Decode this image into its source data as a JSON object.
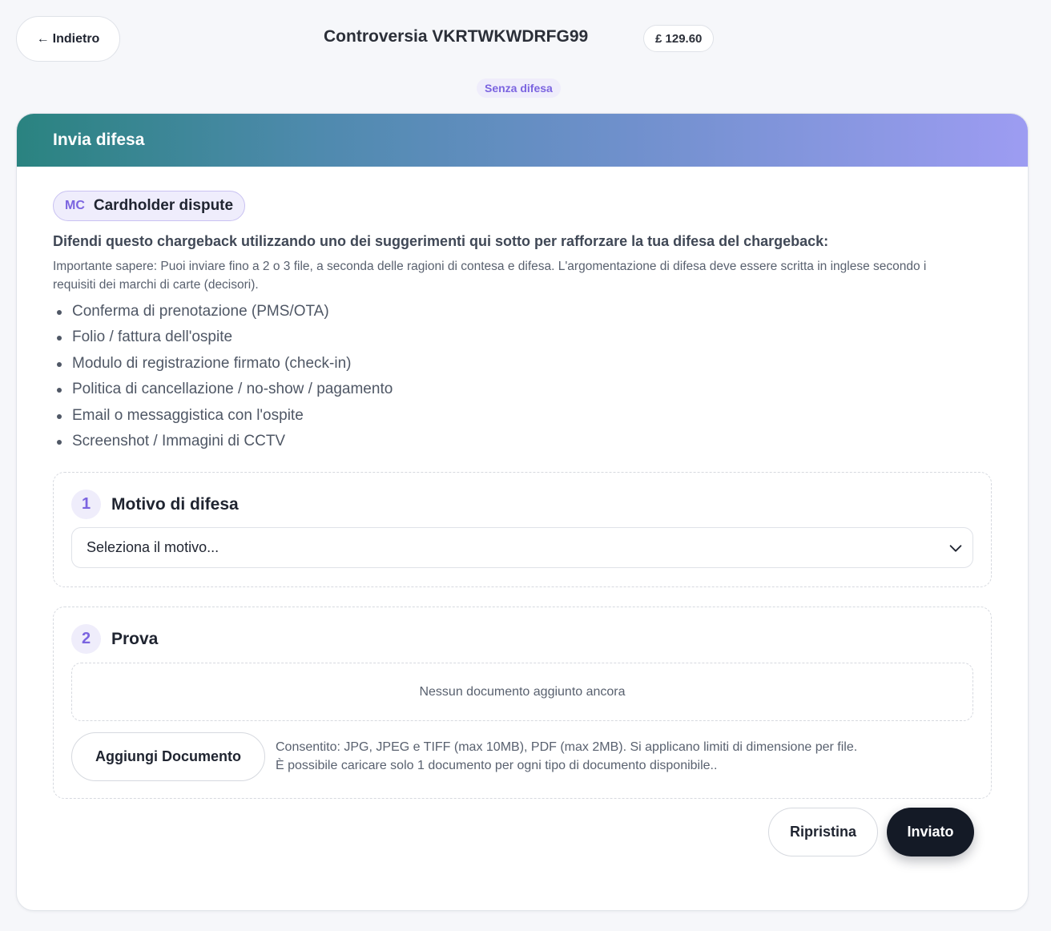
{
  "header": {
    "back_label": "Indietro",
    "back_arrow": "←",
    "title": "Controversia VKRTWKWDRFG99",
    "amount": "£ 129.60",
    "status": "Senza difesa"
  },
  "card": {
    "title": "Invia difesa",
    "scheme_code": "MC",
    "scheme_label": "Cardholder dispute",
    "lead": "Difendi questo chargeback utilizzando uno dei suggerimenti qui sotto per rafforzare la tua difesa del chargeback:",
    "note": "Importante sapere: Puoi inviare fino a 2 o 3 file, a seconda delle ragioni di contesa e difesa. L'argomentazione di difesa deve essere scritta in inglese secondo i requisiti dei marchi di carte (decisori).",
    "suggestions": [
      "Conferma di prenotazione (PMS/OTA)",
      "Folio / fattura dell'ospite",
      "Modulo di registrazione firmato (check-in)",
      "Politica di cancellazione / no-show / pagamento",
      "Email o messaggistica con l'ospite",
      "Screenshot / Immagini di CCTV"
    ]
  },
  "reason_section": {
    "step": "1",
    "title": "Motivo di difesa",
    "select_value": "Seleziona il motivo..."
  },
  "evidence_section": {
    "step": "2",
    "title": "Prova",
    "empty_text": "Nessun documento aggiunto ancora",
    "add_label": "Aggiungi Documento",
    "allowed_line1": "Consentito: JPG, JPEG e TIFF (max 10MB), PDF (max 2MB). Si applicano limiti di dimensione per file.",
    "allowed_line2": "È possibile caricare solo 1 documento per ogni tipo di documento disponibile.."
  },
  "actions": {
    "reset_label": "Ripristina",
    "submit_label": "Inviato"
  },
  "colors": {
    "accent": "#7b64e0",
    "header_gradient_start": "#2a8380",
    "header_gradient_end": "#9d9cf2",
    "primary_button": "#141a26"
  }
}
